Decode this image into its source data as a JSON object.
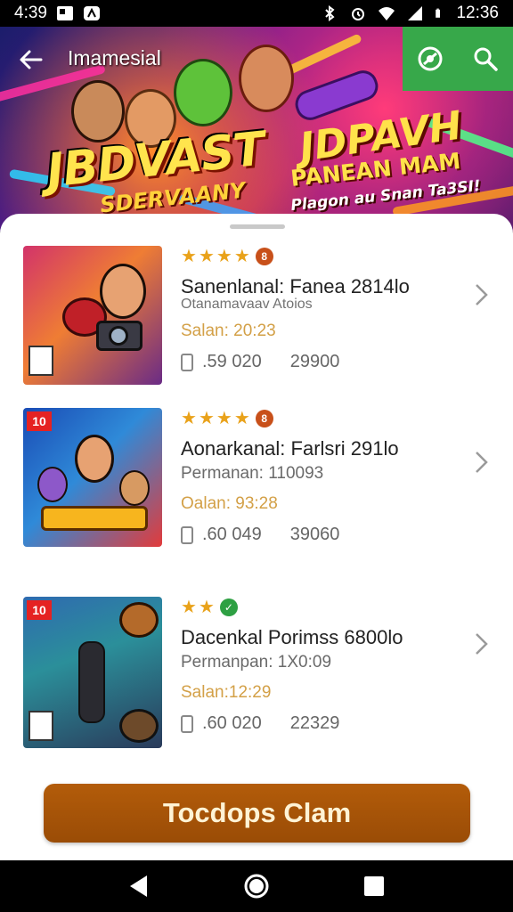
{
  "status_bar": {
    "time_left": "4:39",
    "time_right": "12:36"
  },
  "app_bar": {
    "title": "Imamesial"
  },
  "hero": {
    "title_main": "JBDVAST",
    "title_sub": "SDERVAANY",
    "right_main": "JDPAVH",
    "right_line2": "PANEAN MAM",
    "right_line3": "Plagon au Snan Ta3SI!"
  },
  "items": [
    {
      "title": "Sanenlanal: Fanea 2814lo",
      "subtitle": "Otanamavaav Atoios",
      "plan": "",
      "price": "Salan: 20:23",
      "downloads": ".59 020",
      "count": "29900",
      "stars": 4,
      "badge": "8",
      "badge_color": "#c8501a"
    },
    {
      "title": "Aonarkanal: Farlsri 291lo",
      "subtitle": "",
      "plan": "Permanan: 110093",
      "price": "Oalan: 93:28",
      "downloads": ".60 049",
      "count": "39060",
      "stars": 4,
      "badge": "8",
      "badge_color": "#c8501a"
    },
    {
      "title": "Dacenkal Porimss 6800lo",
      "subtitle": "",
      "plan": "Permanpan: 1X0:09",
      "price": "Salan:12:29",
      "downloads": ".60 020",
      "count": "22329",
      "stars": 2,
      "badge": "✓",
      "badge_color": "#2ea043"
    }
  ],
  "cta": {
    "label": "Tocdops Clam"
  },
  "colors": {
    "accent_green": "#37a84a",
    "cta_brown": "#9a4c06",
    "star": "#e9a21a",
    "price": "#d3a047"
  }
}
